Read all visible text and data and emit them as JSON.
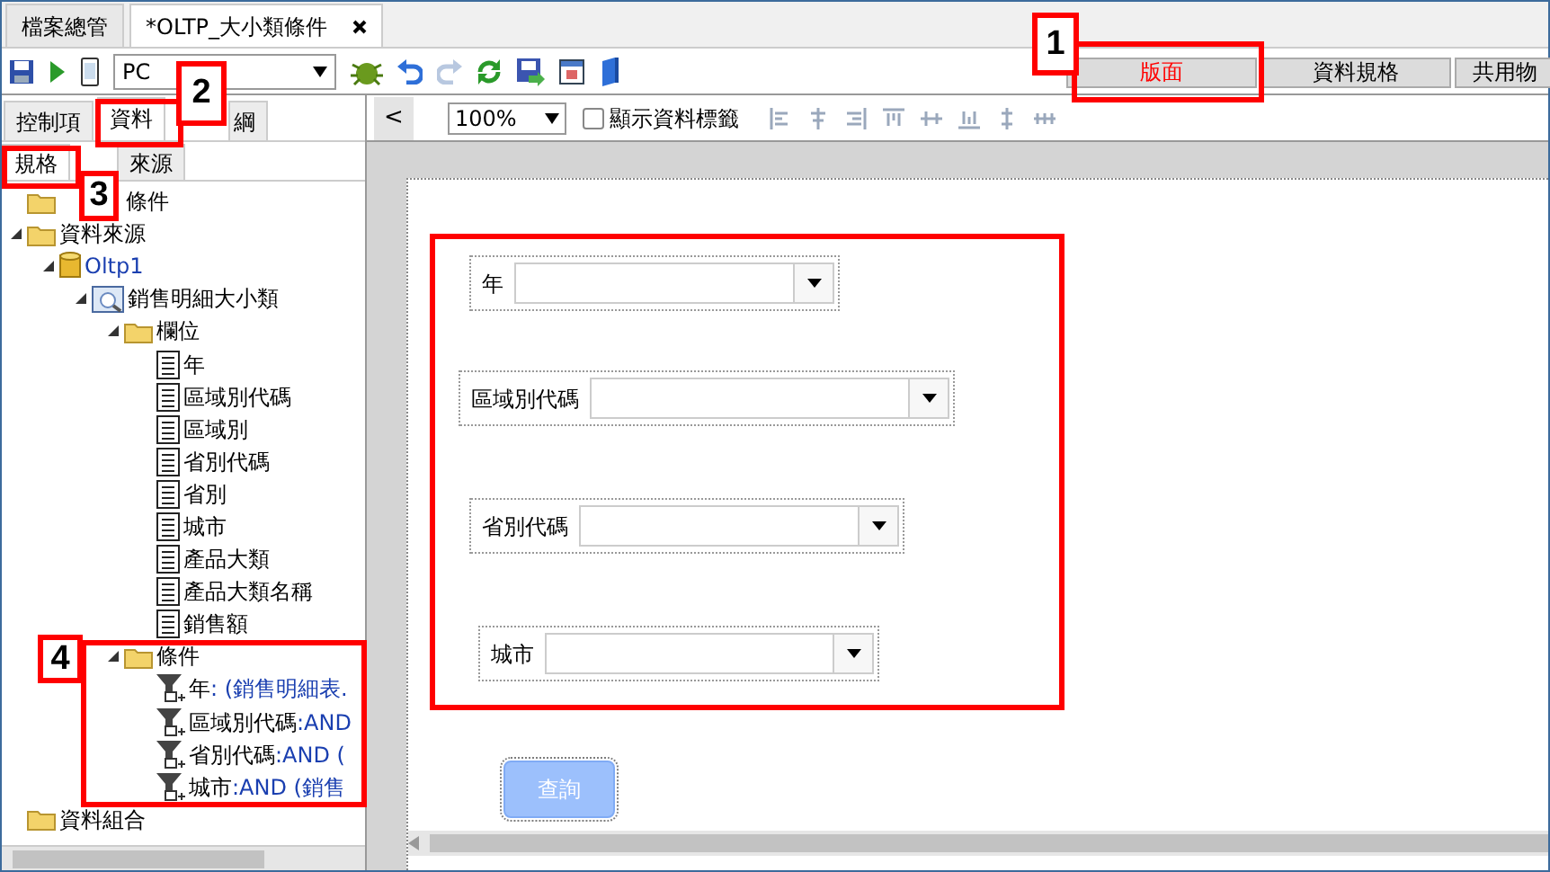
{
  "document_tabs": [
    {
      "label": "檔案總管",
      "selected": false,
      "closable": false
    },
    {
      "label": "*OLTP_大小類條件",
      "selected": true,
      "closable": true
    }
  ],
  "toolbar": {
    "device": "PC"
  },
  "layout_tabs": [
    {
      "label": "版面",
      "selected": true
    },
    {
      "label": "資料規格",
      "selected": false
    },
    {
      "label": "共用物",
      "selected": false
    }
  ],
  "left_tabs": [
    {
      "label": "控制項",
      "selected": false
    },
    {
      "label": "資料",
      "selected": true
    },
    {
      "label": "綱",
      "selected": false
    }
  ],
  "sub_tabs": [
    {
      "label": "規格",
      "selected": true
    },
    {
      "label": "來源",
      "selected": false
    }
  ],
  "tree": [
    {
      "kind": "folder",
      "label": "條件"
    },
    {
      "kind": "folder",
      "label": "資料來源",
      "expanded": true,
      "children": [
        {
          "kind": "database",
          "label": "Oltp1",
          "expanded": true,
          "children": [
            {
              "kind": "table",
              "label": "銷售明細大小類",
              "expanded": true,
              "children": [
                {
                  "kind": "folder",
                  "label": "欄位",
                  "expanded": true,
                  "children": [
                    {
                      "kind": "field",
                      "label": "年"
                    },
                    {
                      "kind": "field",
                      "label": "區域別代碼"
                    },
                    {
                      "kind": "field",
                      "label": "區域別"
                    },
                    {
                      "kind": "field",
                      "label": "省別代碼"
                    },
                    {
                      "kind": "field",
                      "label": "省別"
                    },
                    {
                      "kind": "field",
                      "label": "城市"
                    },
                    {
                      "kind": "field",
                      "label": "產品大類"
                    },
                    {
                      "kind": "field",
                      "label": "產品大類名稱"
                    },
                    {
                      "kind": "field",
                      "label": "銷售額"
                    }
                  ]
                },
                {
                  "kind": "folder",
                  "label": "條件",
                  "expanded": true,
                  "children": [
                    {
                      "kind": "filter",
                      "label": "年",
                      "detail": ": (銷售明細表."
                    },
                    {
                      "kind": "filter",
                      "label": "區域別代碼",
                      "detail": ":AND"
                    },
                    {
                      "kind": "filter",
                      "label": "省別代碼",
                      "detail": ":AND ("
                    },
                    {
                      "kind": "filter",
                      "label": "城市",
                      "detail": ":AND (銷售"
                    }
                  ]
                }
              ]
            }
          ]
        }
      ]
    },
    {
      "kind": "folder",
      "label": "資料組合"
    }
  ],
  "designer": {
    "nav_button": "<",
    "zoom": "100%",
    "show_labels": {
      "label": "顯示資料標籤",
      "checked": false
    }
  },
  "form": {
    "fields": [
      {
        "label": "年"
      },
      {
        "label": "區域別代碼"
      },
      {
        "label": "省別代碼"
      },
      {
        "label": "城市"
      }
    ],
    "query_button": {
      "label": "查詢",
      "disabled": true
    }
  },
  "annotations": [
    {
      "number": "1"
    },
    {
      "number": "2"
    },
    {
      "number": "3"
    },
    {
      "number": "4"
    }
  ]
}
